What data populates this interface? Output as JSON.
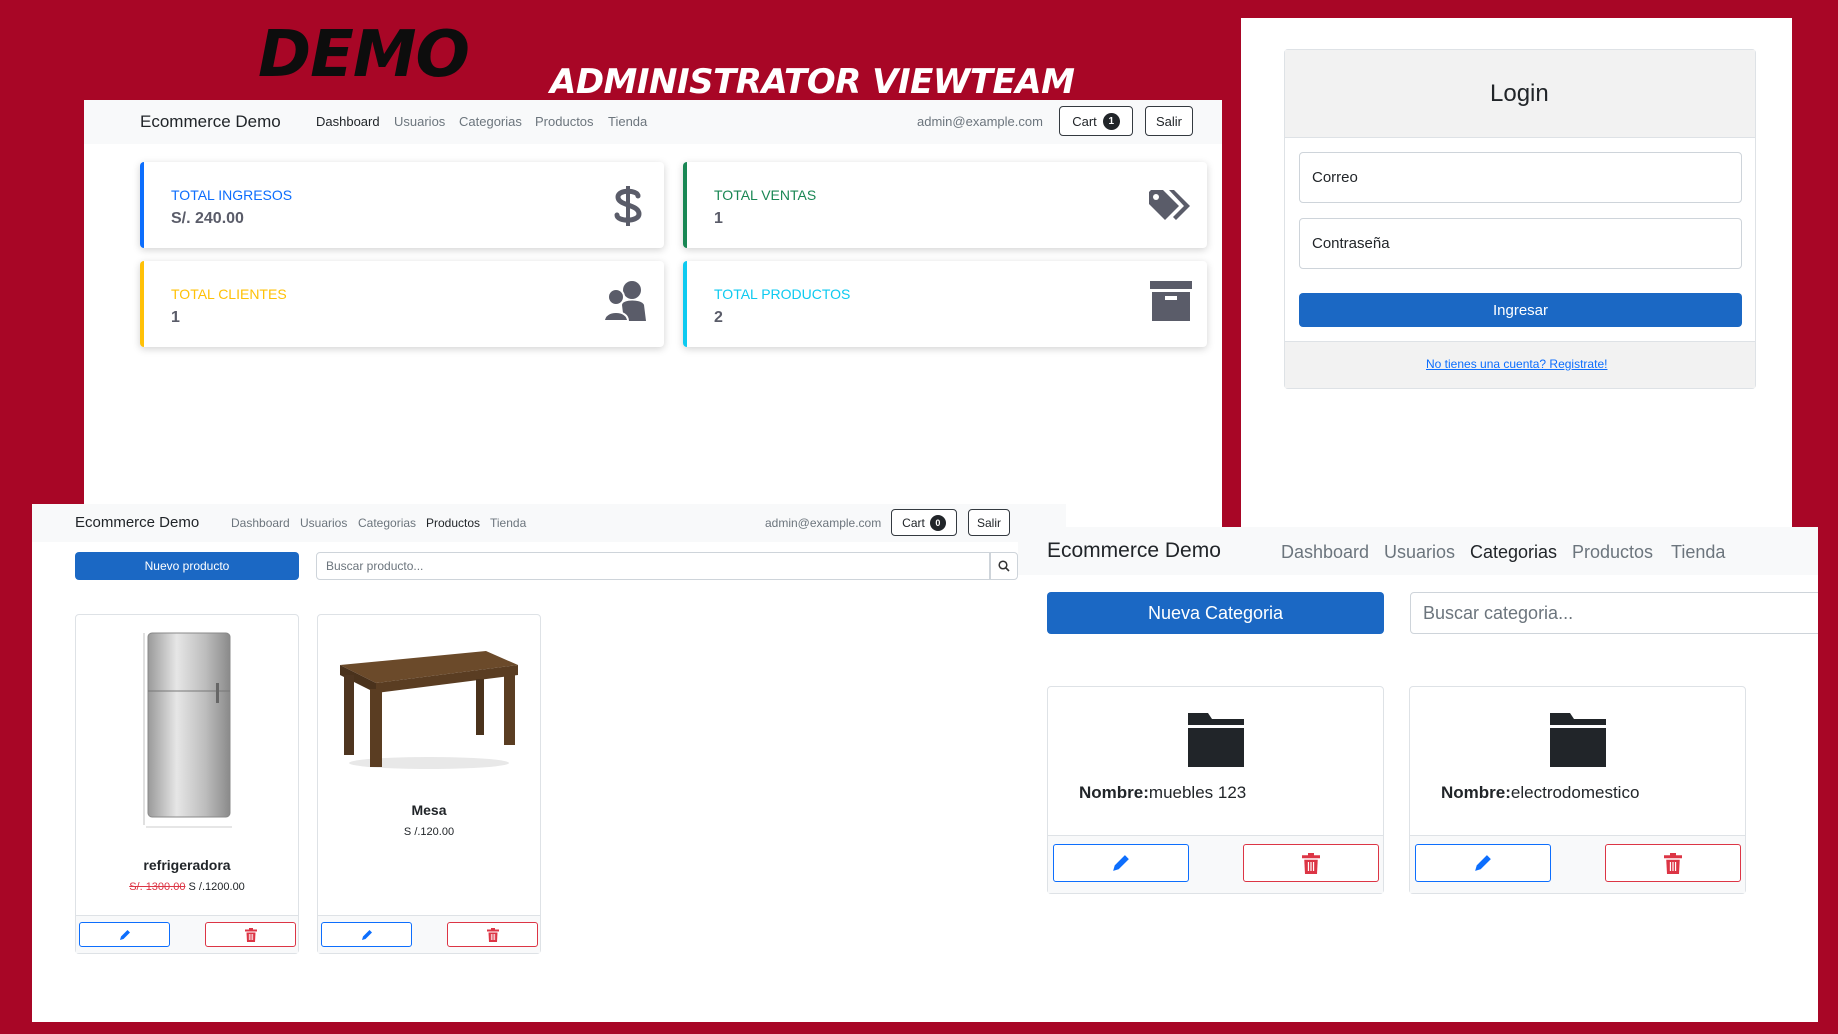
{
  "header": {
    "demo": "DEMO",
    "subtitle": "ADMINISTRATOR VIEWTEAM"
  },
  "dashboard": {
    "brand": "Ecommerce Demo",
    "nav": [
      "Dashboard",
      "Usuarios",
      "Categorias",
      "Productos",
      "Tienda"
    ],
    "active": "Dashboard",
    "user_email": "admin@example.com",
    "cart_label": "Cart",
    "cart_count": "1",
    "logout_label": "Salir",
    "stats": [
      {
        "label": "TOTAL INGRESOS",
        "value": "S/. 240.00",
        "color": "#0d6efd",
        "icon": "dollar-icon"
      },
      {
        "label": "TOTAL VENTAS",
        "value": "1",
        "color": "#198754",
        "icon": "tags-icon"
      },
      {
        "label": "TOTAL CLIENTES",
        "value": "1",
        "color": "#ffc107",
        "icon": "users-icon"
      },
      {
        "label": "TOTAL PRODUCTOS",
        "value": "2",
        "color": "#0dcaf0",
        "icon": "archive-icon"
      }
    ]
  },
  "login": {
    "title": "Login",
    "email_placeholder": "Correo",
    "password_placeholder": "Contraseña",
    "submit_label": "Ingresar",
    "register_link": "No tienes una cuenta? Registrate!"
  },
  "products": {
    "brand": "Ecommerce Demo",
    "nav": [
      "Dashboard",
      "Usuarios",
      "Categorias",
      "Productos",
      "Tienda"
    ],
    "active": "Productos",
    "user_email": "admin@example.com",
    "cart_label": "Cart",
    "cart_count": "0",
    "logout_label": "Salir",
    "new_button": "Nuevo producto",
    "search_placeholder": "Buscar producto...",
    "items": [
      {
        "name": "refrigeradora",
        "old_price": "S/. 1300.00",
        "price": "S /.1200.00",
        "image": "refrigerator-image"
      },
      {
        "name": "Mesa",
        "old_price": "",
        "price": "S /.120.00",
        "image": "table-image"
      }
    ]
  },
  "categories": {
    "brand": "Ecommerce Demo",
    "nav": [
      "Dashboard",
      "Usuarios",
      "Categorias",
      "Productos",
      "Tienda"
    ],
    "active": "Categorias",
    "new_button": "Nueva Categoria",
    "search_placeholder": "Buscar categoria...",
    "name_label": "Nombre:",
    "items": [
      {
        "name": "muebles 123"
      },
      {
        "name": "electrodomestico"
      }
    ]
  },
  "colors": {
    "background": "#a80626",
    "primary": "#1b68c4",
    "edit": "#0d6efd",
    "delete": "#dc3545"
  }
}
